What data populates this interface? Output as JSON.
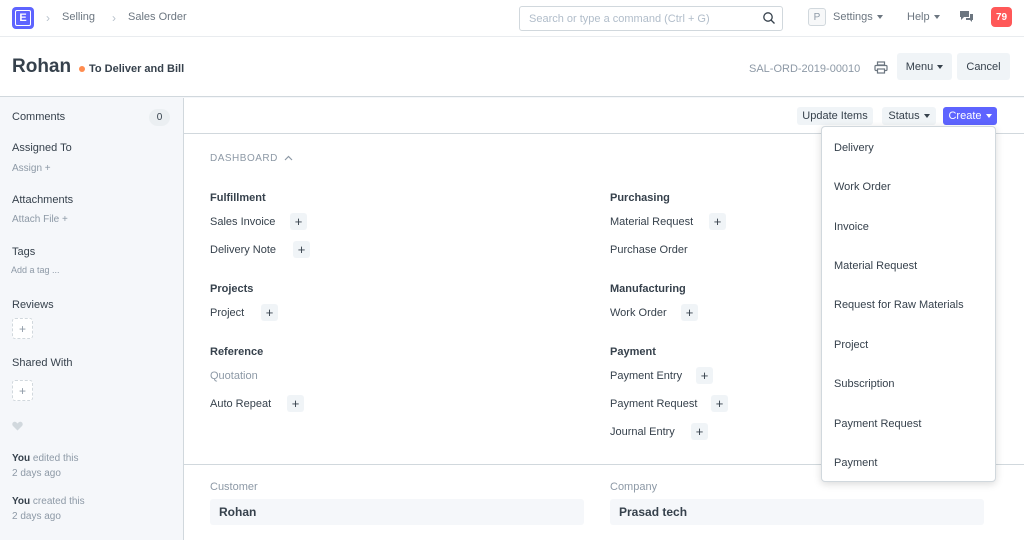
{
  "nav": {
    "logo_letter": "E",
    "breadcrumbs": [
      "Selling",
      "Sales Order"
    ],
    "search_placeholder": "Search or type a command (Ctrl + G)",
    "avatar_letter": "P",
    "settings_label": "Settings",
    "help_label": "Help",
    "notification_count": "79"
  },
  "header": {
    "title": "Rohan",
    "status": "To Deliver and Bill",
    "status_color": "#ff8c4f",
    "doc_name": "SAL-ORD-2019-00010",
    "menu_label": "Menu",
    "cancel_label": "Cancel"
  },
  "sidebar": {
    "comments_label": "Comments",
    "comments_count": "0",
    "assigned_label": "Assigned To",
    "assign_action": "Assign",
    "attachments_label": "Attachments",
    "attach_action": "Attach File",
    "tags_label": "Tags",
    "tags_placeholder": "Add a tag ...",
    "reviews_label": "Reviews",
    "shared_label": "Shared With",
    "activity": [
      {
        "who": "You",
        "what": " edited this",
        "when": "2 days ago"
      },
      {
        "who": "You",
        "what": " created this",
        "when": "2 days ago"
      }
    ]
  },
  "toolbar": {
    "update_items": "Update Items",
    "status": "Status",
    "create": "Create",
    "create_color": "#5e64ff"
  },
  "dashboard": {
    "heading": "DASHBOARD",
    "groups": {
      "fulfillment": {
        "title": "Fulfillment",
        "items": [
          "Sales Invoice",
          "Delivery Note"
        ]
      },
      "projects": {
        "title": "Projects",
        "items": [
          "Project"
        ]
      },
      "reference": {
        "title": "Reference",
        "items": [
          "Quotation",
          "Auto Repeat"
        ]
      },
      "purchasing": {
        "title": "Purchasing",
        "items": [
          "Material Request",
          "Purchase Order"
        ]
      },
      "manufacturing": {
        "title": "Manufacturing",
        "items": [
          "Work Order"
        ]
      },
      "payment": {
        "title": "Payment",
        "items": [
          "Payment Entry",
          "Payment Request",
          "Journal Entry"
        ]
      }
    }
  },
  "form": {
    "customer_label": "Customer",
    "customer_value": "Rohan",
    "company_label": "Company",
    "company_value": "Prasad tech"
  },
  "create_menu": [
    "Delivery",
    "Work Order",
    "Invoice",
    "Material Request",
    "Request for Raw Materials",
    "Project",
    "Subscription",
    "Payment Request",
    "Payment"
  ]
}
